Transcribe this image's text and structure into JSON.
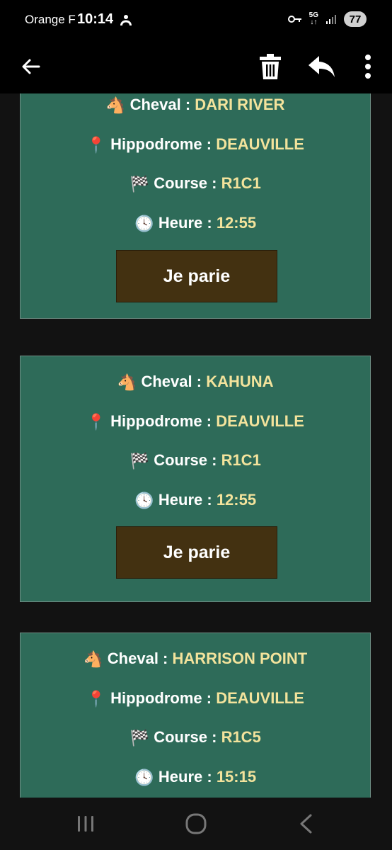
{
  "status_bar": {
    "carrier": "Orange F",
    "time": "10:14",
    "network": "5G",
    "battery": "77"
  },
  "app_bar": {
    "icons": [
      "back-arrow-icon",
      "trash-icon",
      "reply-icon",
      "more-vert-icon"
    ]
  },
  "labels": {
    "horse": "Cheval :",
    "track": "Hippodrome :",
    "race": "Course :",
    "time": "Heure :",
    "bet": "Je parie"
  },
  "emojis": {
    "horse": "🐴",
    "track": "📍",
    "race": "🏁",
    "time": "🕓"
  },
  "cards": [
    {
      "horse": "DARI RIVER",
      "track": "DEAUVILLE",
      "race": "R1C1",
      "time": "12:55"
    },
    {
      "horse": "KAHUNA",
      "track": "DEAUVILLE",
      "race": "R1C1",
      "time": "12:55"
    },
    {
      "horse": "HARRISON POINT",
      "track": "DEAUVILLE",
      "race": "R1C5",
      "time": "15:15"
    }
  ],
  "colors": {
    "card_bg": "#2e6b59",
    "value_text": "#f3e39c",
    "button_bg": "#433111",
    "page_bg": "#121212"
  }
}
